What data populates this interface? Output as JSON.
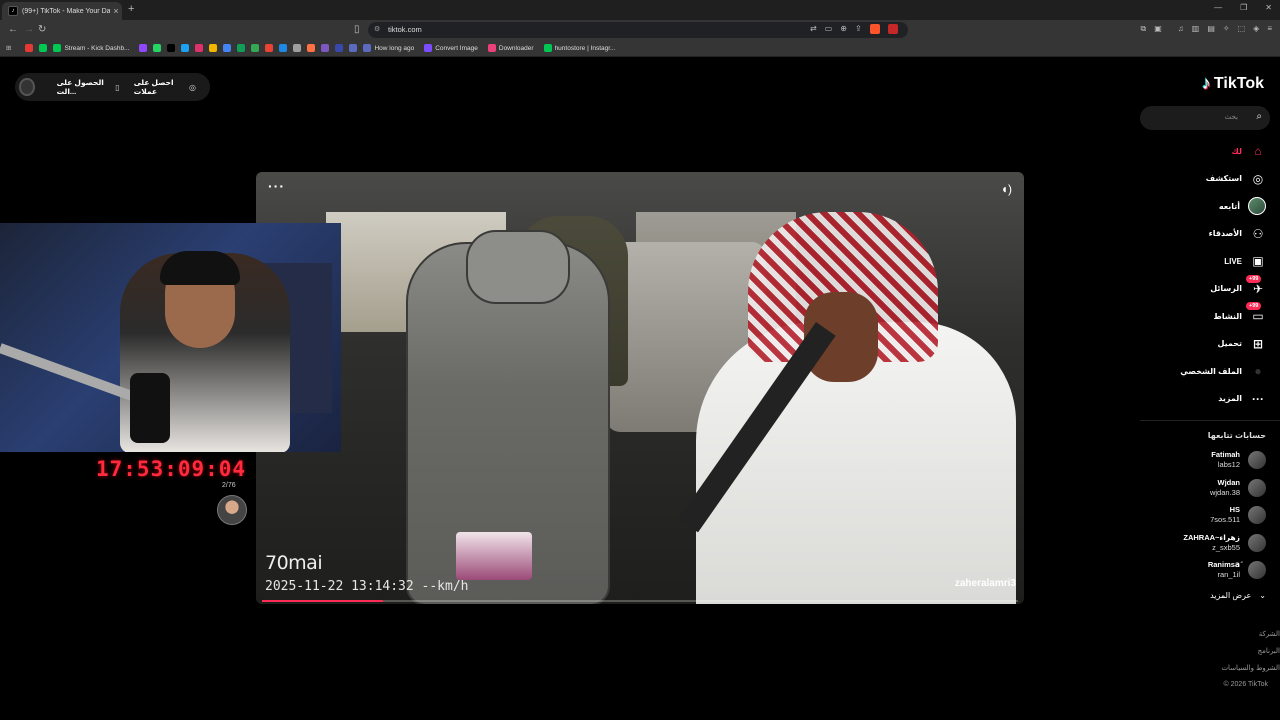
{
  "browser": {
    "tab_title": "(99+) TikTok - Make Your Day",
    "tab_icon": "tiktok-icon",
    "url": "tiktok.com",
    "bookmarks": [
      {
        "label": "",
        "color": "#e53935"
      },
      {
        "label": "",
        "color": "#00c853"
      },
      {
        "label": "Stream - Kick Dashb...",
        "color": "#00c853"
      },
      {
        "label": "",
        "color": "#9146ff"
      },
      {
        "label": "",
        "color": "#25d366"
      },
      {
        "label": "",
        "color": "#000000"
      },
      {
        "label": "",
        "color": "#1da1f2"
      },
      {
        "label": "",
        "color": "#e1306c"
      },
      {
        "label": "",
        "color": "#f4b400"
      },
      {
        "label": "",
        "color": "#4285f4"
      },
      {
        "label": "",
        "color": "#0f9d58"
      },
      {
        "label": "",
        "color": "#34a853"
      },
      {
        "label": "",
        "color": "#ea4335"
      },
      {
        "label": "",
        "color": "#1e88e5"
      },
      {
        "label": "",
        "color": "#9e9e9e"
      },
      {
        "label": "",
        "color": "#ff7043"
      },
      {
        "label": "",
        "color": "#7e57c2"
      },
      {
        "label": "",
        "color": "#3949ab"
      },
      {
        "label": "",
        "color": "#5c6bc0"
      },
      {
        "label": "How long ago",
        "color": "#5c6bc0"
      },
      {
        "label": "Convert Image",
        "color": "#7c4dff"
      },
      {
        "label": "Downloader",
        "color": "#ec407a"
      },
      {
        "label": "huntostore | Instagr...",
        "color": "#00c853"
      }
    ]
  },
  "page": {
    "get_pill": {
      "chip1": "احصل على عملات",
      "chip2": "الحصول على الت..."
    },
    "logo_text": "TikTok",
    "search_placeholder": "بحث",
    "nav": [
      {
        "label": "لك",
        "icon": "home-icon",
        "active": true
      },
      {
        "label": "استكشف",
        "icon": "compass-icon"
      },
      {
        "label": "أتابعه",
        "icon": "avatar-following-icon"
      },
      {
        "label": "الأصدقاء",
        "icon": "friends-icon"
      },
      {
        "label": "LIVE",
        "icon": "live-icon"
      },
      {
        "label": "الرسائل",
        "icon": "messages-icon",
        "badge": "+99"
      },
      {
        "label": "النشاط",
        "icon": "activity-icon",
        "badge": "+99"
      },
      {
        "label": "تحميل",
        "icon": "upload-icon"
      },
      {
        "label": "الملف الشخصي",
        "icon": "profile-icon"
      },
      {
        "label": "المزيد",
        "icon": "more-icon"
      }
    ],
    "following_title": "حسابات تتابعها",
    "accounts": [
      {
        "name": "Fatimah",
        "user": "labs12"
      },
      {
        "name": "Wjdan",
        "user": "wjdan.38"
      },
      {
        "name": "HS",
        "user": "7sos.511"
      },
      {
        "name": "ZAHRAA~زهراء",
        "user": "z_sxb55"
      },
      {
        "name": "Ranimsaَ",
        "user": "ran_1il"
      }
    ],
    "see_more": "عرض المزيد",
    "footer": [
      "الشركة",
      "البرنامج",
      "الشروط والسياسات",
      "© 2026 TikTok"
    ],
    "video": {
      "cam_brand": "70mai",
      "cam_stamp": "2025-11-22  13:14:32  --km/h",
      "author": "zaheralamri3",
      "progress": 0.16
    },
    "overlay": {
      "clock": "17:53:09:04",
      "clock_sub": "2/76"
    }
  },
  "colors": {
    "accent": "#fe2c55",
    "clock": "#ff2a3c"
  }
}
